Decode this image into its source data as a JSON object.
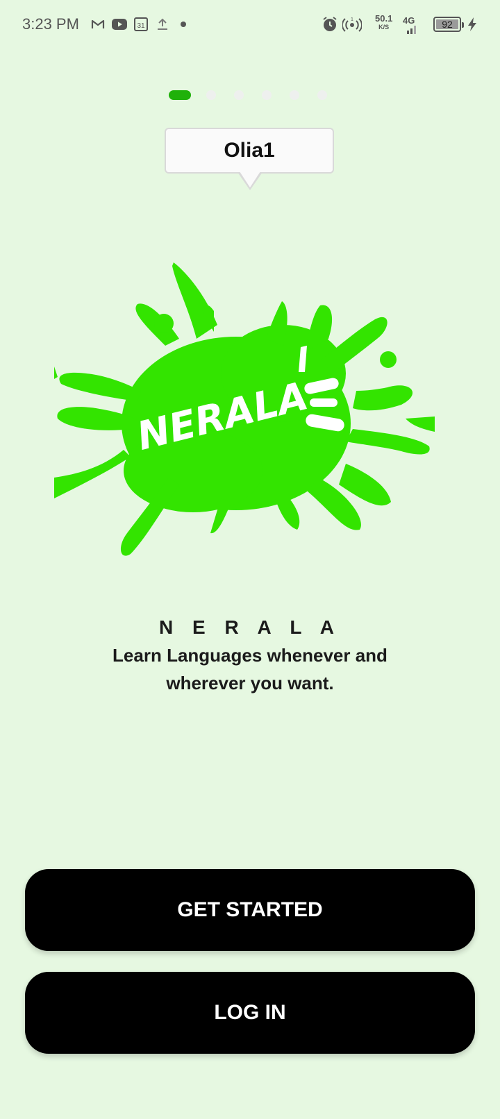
{
  "status_bar": {
    "time": "3:23 PM",
    "icons": [
      "gmail-icon",
      "youtube-icon",
      "calendar-icon",
      "upload-icon",
      "dot-icon",
      "alarm-icon",
      "hotspot-icon",
      "signal-icon",
      "charging-icon"
    ],
    "calendar_day": "31",
    "hotspot_count": "1",
    "net_speed": "50.1",
    "net_speed_unit": "K/S",
    "network_type": "4G",
    "battery_percent": "92"
  },
  "pager": {
    "count": 6,
    "active_index": 0,
    "active_color": "#1fb10a"
  },
  "tooltip": {
    "text": "Olia1"
  },
  "logo": {
    "text": "NERALA",
    "color": "#33e400"
  },
  "intro": {
    "brand": "N E R A L A",
    "tagline": "Learn Languages whenever and wherever you want."
  },
  "actions": {
    "get_started_label": "GET STARTED",
    "login_label": "LOG IN"
  },
  "colors": {
    "background": "#E6F8E1",
    "button": "#000000",
    "button_text": "#ffffff"
  }
}
